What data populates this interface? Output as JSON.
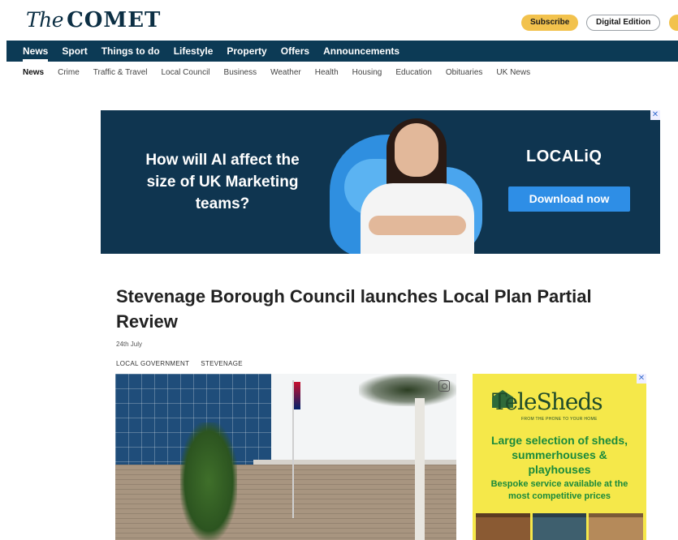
{
  "header": {
    "logo_the": "The",
    "logo_name": "COMET",
    "subscribe_label": "Subscribe",
    "digital_edition_label": "Digital Edition"
  },
  "main_nav": {
    "items": [
      "News",
      "Sport",
      "Things to do",
      "Lifestyle",
      "Property",
      "Offers",
      "Announcements"
    ],
    "active": "News"
  },
  "sub_nav": {
    "items": [
      "News",
      "Crime",
      "Traffic & Travel",
      "Local Council",
      "Business",
      "Weather",
      "Health",
      "Housing",
      "Education",
      "Obituaries",
      "UK News"
    ],
    "active": "News"
  },
  "ad_banner": {
    "headline": "How will AI affect the size of UK Marketing teams?",
    "brand": "LOCALiQ",
    "cta": "Download now",
    "close": "✕"
  },
  "article": {
    "headline": "Stevenage Borough Council launches Local Plan Partial Review",
    "date": "24th July",
    "tags": [
      "LOCAL GOVERNMENT",
      "STEVENAGE"
    ]
  },
  "side_ad": {
    "logo": "TeleSheds",
    "tagline": "FROM THE PHONE TO YOUR HOME",
    "headline": "Large selection of sheds, summerhouses & playhouses",
    "subtext": "Bespoke service available at the most competitive prices",
    "close": "✕"
  },
  "colors": {
    "nav_bg": "#0c3a55",
    "subscribe_bg": "#f2c24d",
    "ad_bg": "#0f3550",
    "side_ad_bg": "#f5e84a",
    "side_ad_text": "#1a8a3c"
  }
}
